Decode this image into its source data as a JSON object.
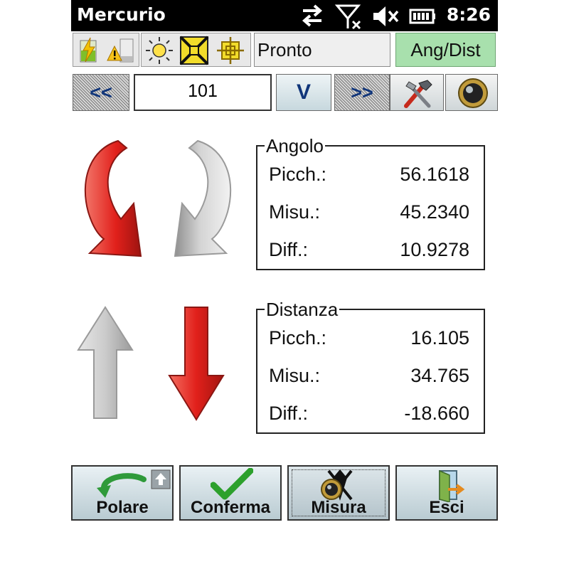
{
  "status_bar": {
    "app_title": "Mercurio",
    "time": "8:26"
  },
  "toolbar": {
    "status_text": "Pronto",
    "mode_label": "Ang/Dist",
    "prev_label": "<<",
    "next_label": ">>",
    "point_number": "101",
    "v_label": "V"
  },
  "angle_group": {
    "title": "Angolo",
    "rows": [
      {
        "label": "Picch.:",
        "value": "56.1618"
      },
      {
        "label": "Misu.:",
        "value": "45.2340"
      },
      {
        "label": "Diff.:",
        "value": "10.9278"
      }
    ]
  },
  "distance_group": {
    "title": "Distanza",
    "rows": [
      {
        "label": "Picch.:",
        "value": "16.105"
      },
      {
        "label": "Misu.:",
        "value": "34.765"
      },
      {
        "label": "Diff.:",
        "value": "-18.660"
      }
    ]
  },
  "buttons": {
    "polare": "Polare",
    "conferma": "Conferma",
    "misura": "Misura",
    "esci": "Esci"
  },
  "icons": {
    "status": [
      "transfer-icon",
      "no-signal-icon",
      "mute-icon",
      "battery-icon"
    ],
    "toolbar": [
      "battery-charge-icon",
      "battery-warning-icon",
      "sun-icon",
      "target-icon",
      "prism-icon"
    ],
    "tools": [
      "tools-icon",
      "prism-lens-icon"
    ]
  },
  "colors": {
    "accent_red": "#e1201b",
    "mode_green": "#a8e0ad",
    "hint_gray": "#c8c8c8"
  }
}
